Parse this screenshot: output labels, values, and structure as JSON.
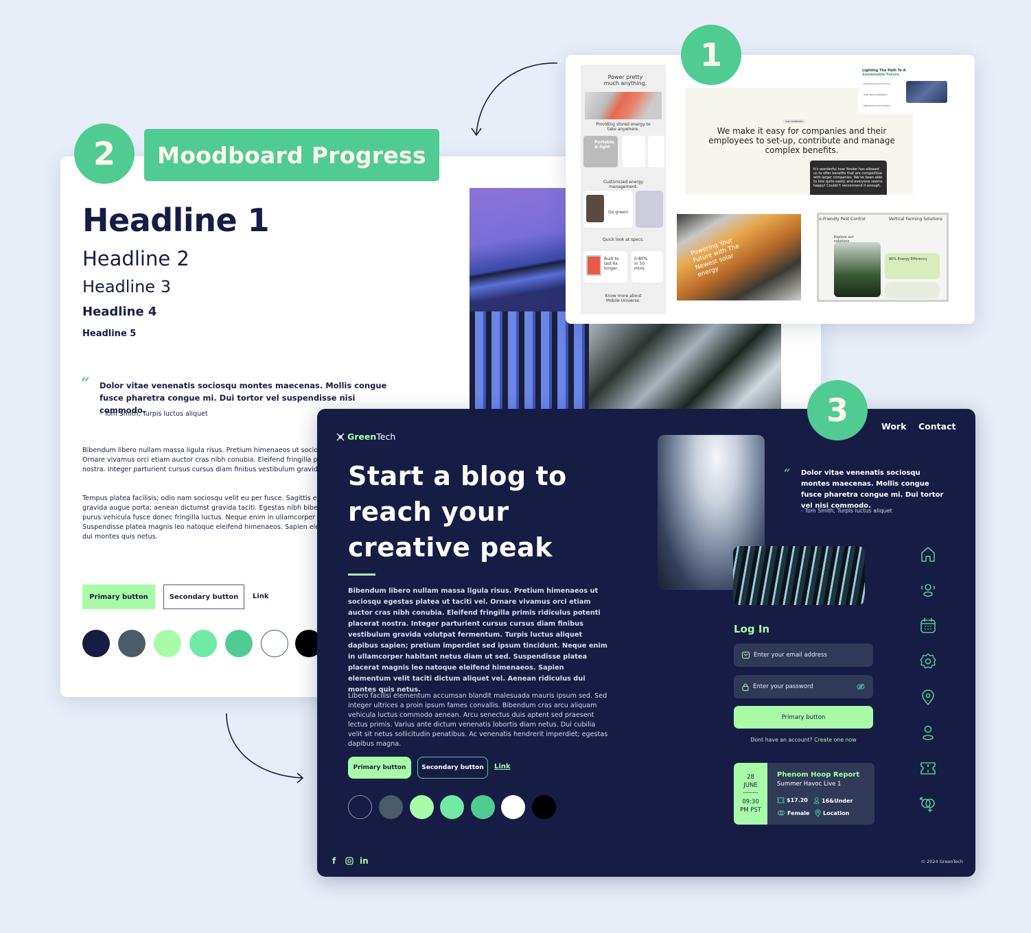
{
  "colors": {
    "background": "#e8eef8",
    "accent_green": "#50cc93",
    "navy": "#171c45",
    "light_green": "#a8fca8",
    "badge_text": "#fff8ee"
  },
  "badges": {
    "step1": "1",
    "step2": "2",
    "step3": "3"
  },
  "moodboard": {
    "title": "Moodboard Progress",
    "headlines": [
      "Headline 1",
      "Headline 2",
      "Headline 3",
      "Headline 4",
      "Headline 5"
    ],
    "quote_mark": "“",
    "quote": "Dolor vitae venenatis sociosqu montes maecenas. Mollis congue fusce pharetra congue mi. Dui tortor vel suspendisse nisi commodo.",
    "quote_author": "- Tom Smith, Turpis luctus aliquet",
    "paragraph1": "Bibendum libero nullam massa ligula risus. Pretium himenaeos ut sociosqu egestas platea ut taciti vel. Ornare vivamus orci etiam auctor cras nibh conubia. Eleifend fringilla primis ridiculus potenti placerat nostra. Integer parturient cursus cursus diam finibus vestibulum gravida volutpat fermentum.",
    "paragraph2": "Tempus platea facilisis; odio nam sociosqu velit eu per fusce. Sagittis eu aucto nisl molestie. Pulvinar gravida augue porta; aenean dictumst gravida taciti. Egestas nibh bibendum pharetra. Senectus potenti purus vehicula fusce donec fringilla luctus. Neque enim in ullamcorper habitant netus diam ut sed. Suspendisse platea magnis leo natoque eleifend himenaeos. Sapien elementum velit taciti dictum ridiculus dui montes quis netus.",
    "primary_button": "Primary button",
    "secondary_button": "Secondary button",
    "link": "Link",
    "swatches": [
      "#171c45",
      "#4a5a66",
      "#a8fca8",
      "#70eaa4",
      "#50cc93",
      "#ffffff",
      "#000000"
    ]
  },
  "inspiration": {
    "phone": {
      "headline": "Power pretty much anything.",
      "section1": "Providing stored energy to take anywhere.",
      "card1": "Portable & light",
      "section2": "Customized energy management.",
      "card2": "Go green!",
      "section3": "Quick look at specs.",
      "card3": "Built to last 6x longer.",
      "card4": "0-80% in 50 mins.",
      "footer": "Know more about Mobile Universe."
    },
    "community": {
      "tag": "OUR COMMUNITY",
      "headline": "We make it easy for companies and their employees to set-up, contribute and manage complex benefits.",
      "testimonial": "It's wonderful how Yonder has allowed us to offer benefits that are competitive with larger companies. We've been able to hire quite easily and everyone seems happy! Couldn't recommend it enough."
    },
    "lighting": {
      "title": "Lighting The Path To A",
      "title_accent": "Sustainable Future",
      "items": [
        "Empowering Our Services",
        "Solar Panel Installation",
        "Maintenance And Support"
      ]
    },
    "solar": {
      "headline": "Powering Your Future with The Newest solar energy"
    },
    "farm": {
      "tabs": [
        "o-Friendly Pest Control",
        "Vertical Farming Solutions"
      ],
      "explore": "Explore our solutions",
      "stat": "80% Energy Efficiency"
    }
  },
  "greentech": {
    "logo_part1": "Green",
    "logo_part2": "Tech",
    "nav": [
      "Work",
      "Contact"
    ],
    "hero": "Start a blog to reach your creative peak",
    "body_bold": "Bibendum libero nullam massa ligula risus. Pretium himenaeos ut sociosqu egestas platea ut taciti vel. Ornare vivamus orci etiam auctor cras nibh conubia. Eleifend fringilla primis ridiculus potenti placerat nostra. Integer parturient cursus cursus diam finibus vestibulum gravida volutpat fermentum. Turpis luctus aliquet dapibus sapien; pretium imperdiet sed ipsum tincidunt. Neque enim in ullamcorper habitant netus diam ut sed. Suspendisse platea placerat magnis leo natoque eleifend himenaeos. Sapien elementum velit taciti dictum aliquet vel. Aenean ridiculus dui montes quis netus.",
    "body_regular": "Libero facilisi elementum accumsan blandit malesuada mauris ipsum sed. Sed integer ultrices a proin ipsum fames convallis. Bibendum cras arcu aliquam vehicula luctus commodo aenean. Arcu senectus duis aptent sed praesent lectus primis. Varius ante dictum venenatis lobortis diam netus. Dui cubilia velit sit netus sollicitudin penatibus. Ac venenatis hendrerit imperdiet; egestas dapibus magna.",
    "primary_button": "Primary button",
    "secondary_button": "Secondary button",
    "link": "Link",
    "swatches": [
      "#171c45",
      "#4a5a66",
      "#a8fca8",
      "#70eaa4",
      "#50cc93",
      "#ffffff",
      "#000000"
    ],
    "quote_mark": "“",
    "quote": "Dolor vitae venenatis sociosqu montes maecenas. Mollis congue fusce pharetra congue mi. Dui tortor vel  nisi commodo.",
    "quote_author": "- Tom Smith, Turpis luctus aliquet",
    "login": {
      "title": "Log In",
      "email_placeholder": "Enter your email address",
      "password_placeholder": "Enter your password",
      "submit": "Primary button",
      "signup_prompt": "Dont have an account?",
      "signup_link": "Create one now"
    },
    "event": {
      "day": "28",
      "month": "JUNE",
      "time": "09:30",
      "tz": "PM PST",
      "title": "Phenom Hoop Report",
      "subtitle": "Summer Havoc Live 1",
      "price": "$17.20",
      "age": "16&Under",
      "gender": "Female",
      "location": "Location"
    },
    "rail_icons": [
      "home-icon",
      "users-icon",
      "calendar-icon",
      "settings-icon",
      "location-icon",
      "user-icon",
      "ticket-icon",
      "gender-icon"
    ],
    "social": [
      "f",
      "instagram",
      "in"
    ],
    "copyright": "© 2024 GreenTech"
  }
}
